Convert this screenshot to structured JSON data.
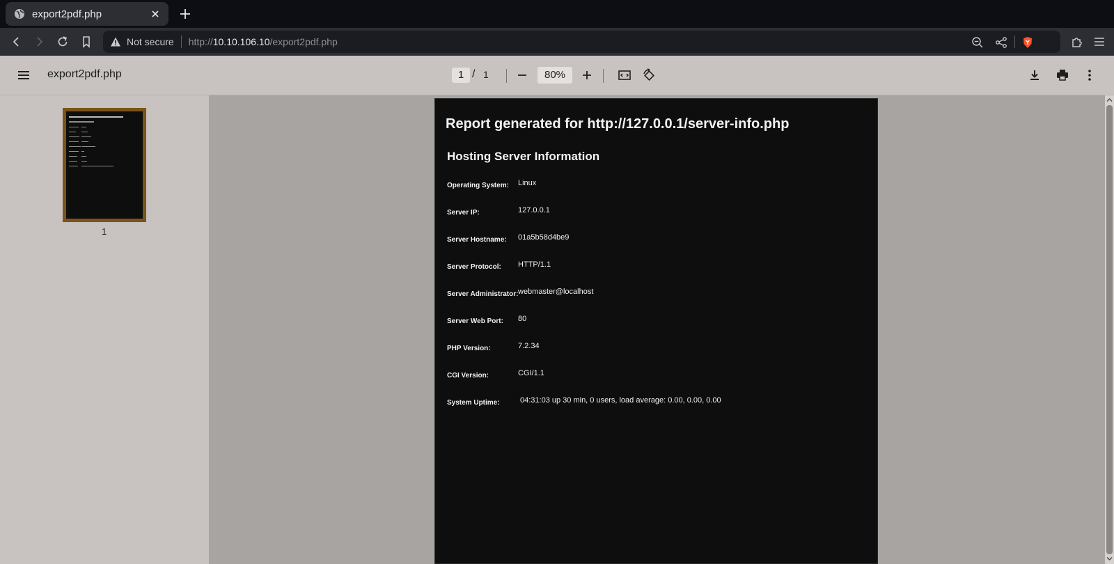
{
  "browser": {
    "tab_title": "export2pdf.php",
    "security_label": "Not secure",
    "url_scheme": "http://",
    "url_host": "10.10.106.10",
    "url_path": "/export2pdf.php"
  },
  "pdf": {
    "title": "export2pdf.php",
    "current_page": "1",
    "page_separator": "/",
    "total_pages": "1",
    "zoom": "80%",
    "thumbnail_label": "1"
  },
  "report": {
    "heading": "Report generated for http://127.0.0.1/server-info.php",
    "subheading": "Hosting Server Information",
    "rows": [
      {
        "label": "Operating System:",
        "value": "Linux"
      },
      {
        "label": "Server IP:",
        "value": "127.0.0.1"
      },
      {
        "label": "Server Hostname:",
        "value": "01a5b58d4be9"
      },
      {
        "label": "Server Protocol:",
        "value": "HTTP/1.1"
      },
      {
        "label": "Server Administrator:",
        "value": "webmaster@localhost"
      },
      {
        "label": "Server Web Port:",
        "value": "80"
      },
      {
        "label": "PHP Version:",
        "value": "7.2.34"
      },
      {
        "label": "CGI Version:",
        "value": "CGI/1.1"
      },
      {
        "label": "System Uptime:",
        "value": "04:31:03 up 30 min, 0 users, load average: 0.00, 0.00, 0.00"
      }
    ]
  },
  "colors": {
    "thumbnail_frame": "#7a5418",
    "page_background": "#0e0e0e",
    "brave_shield": "#fb542b"
  },
  "icons": [
    "globe-icon",
    "close-icon",
    "plus-icon",
    "back-icon",
    "forward-icon",
    "reload-icon",
    "bookmark-icon",
    "warning-icon",
    "zoom-out-icon",
    "share-icon",
    "brave-shield-icon",
    "extensions-icon",
    "menu-icon",
    "hamburger-icon",
    "minus-icon",
    "fit-page-icon",
    "rotate-icon",
    "download-icon",
    "print-icon",
    "more-vert-icon"
  ]
}
